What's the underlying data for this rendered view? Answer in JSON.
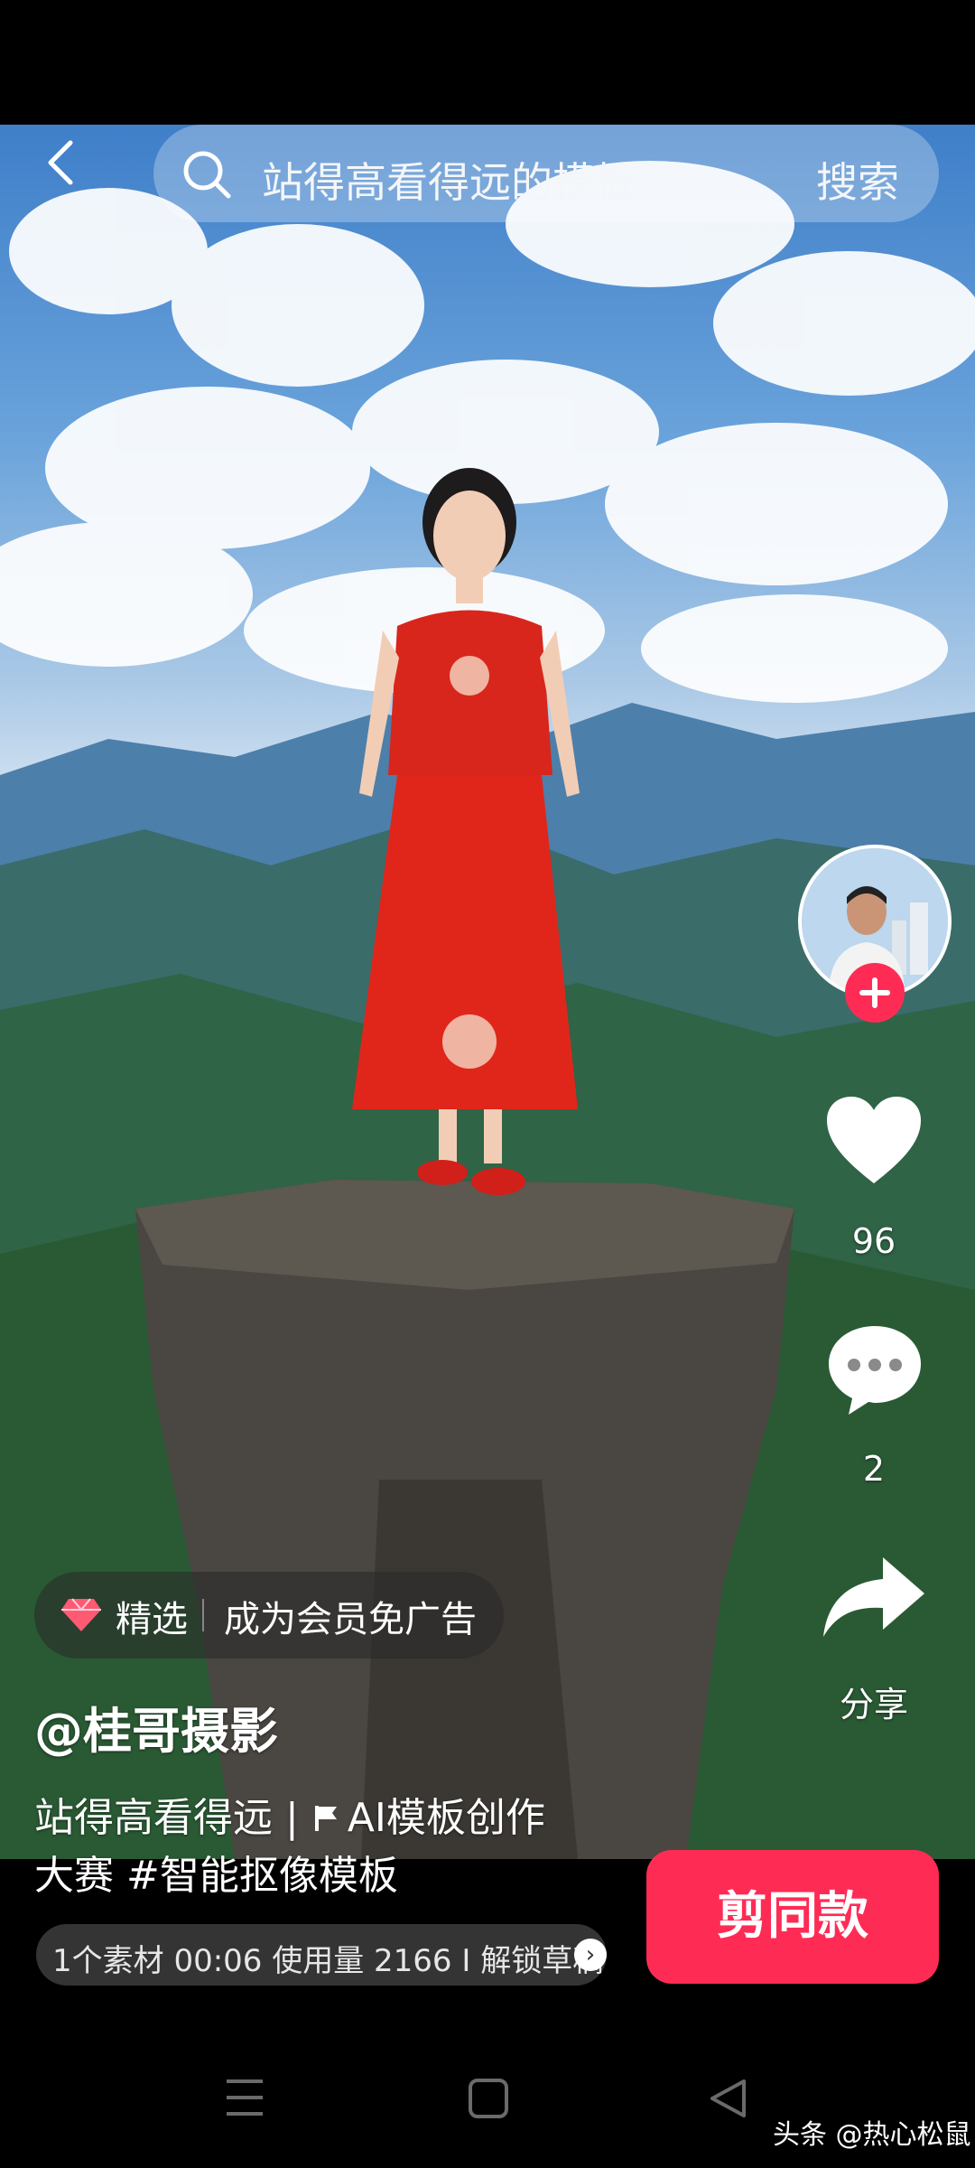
{
  "search": {
    "query": "站得高看得远的模板",
    "button_label": "搜索"
  },
  "rail": {
    "like_count": "96",
    "comment_count": "2",
    "share_label": "分享"
  },
  "promo": {
    "tag": "精选",
    "text": "成为会员免广告"
  },
  "post": {
    "author": "@桂哥摄影",
    "desc_line1_a": "站得高看得远 | ",
    "desc_line1_b": "AI模板创作",
    "desc_line2_a": "大赛 ",
    "desc_line2_b": "#智能抠像模板",
    "meta": "1个素材 00:06 使用量 2166 I 解锁草稿",
    "meta_arrow": "›",
    "cta": "剪同款"
  },
  "watermark": "头条 @热心松鼠",
  "colors": {
    "accent": "#fe2c55"
  }
}
